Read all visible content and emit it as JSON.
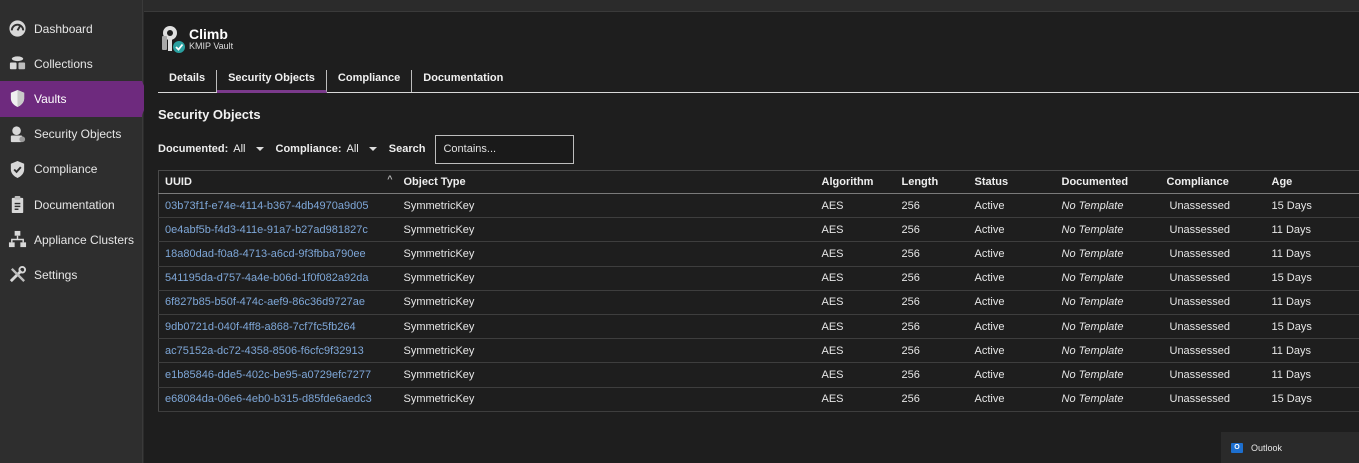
{
  "sidebar": {
    "items": [
      {
        "label": "Dashboard",
        "icon": "dashboard-icon"
      },
      {
        "label": "Collections",
        "icon": "collections-icon"
      },
      {
        "label": "Vaults",
        "icon": "vault-shield-icon",
        "active": true
      },
      {
        "label": "Security Objects",
        "icon": "security-objects-icon"
      },
      {
        "label": "Compliance",
        "icon": "compliance-shield-icon"
      },
      {
        "label": "Documentation",
        "icon": "documentation-icon"
      },
      {
        "label": "Appliance Clusters",
        "icon": "appliance-clusters-icon"
      },
      {
        "label": "Settings",
        "icon": "settings-icon"
      }
    ]
  },
  "header": {
    "title": "Climb",
    "subtitle": "KMIP Vault",
    "icon": "vault-keys-icon"
  },
  "tabs": [
    {
      "label": "Details"
    },
    {
      "label": "Security Objects",
      "active": true
    },
    {
      "label": "Compliance"
    },
    {
      "label": "Documentation"
    }
  ],
  "section": {
    "title": "Security Objects"
  },
  "filters": {
    "documented_label": "Documented:",
    "documented_value": "All",
    "compliance_label": "Compliance:",
    "compliance_value": "All",
    "search_label": "Search",
    "search_placeholder": "Contains..."
  },
  "table": {
    "columns": [
      "UUID",
      "Object Type",
      "Algorithm",
      "Length",
      "Status",
      "Documented",
      "Compliance",
      "Age"
    ],
    "sort_indicator": "^",
    "rows": [
      [
        "03b73f1f-e74e-4114-b367-4db4970a9d05",
        "SymmetricKey",
        "AES",
        "256",
        "Active",
        "No Template",
        "Unassessed",
        "15 Days"
      ],
      [
        "0e4abf5b-f4d3-411e-91a7-b27ad981827c",
        "SymmetricKey",
        "AES",
        "256",
        "Active",
        "No Template",
        "Unassessed",
        "11 Days"
      ],
      [
        "18a80dad-f0a8-4713-a6cd-9f3fbba790ee",
        "SymmetricKey",
        "AES",
        "256",
        "Active",
        "No Template",
        "Unassessed",
        "11 Days"
      ],
      [
        "541195da-d757-4a4e-b06d-1f0f082a92da",
        "SymmetricKey",
        "AES",
        "256",
        "Active",
        "No Template",
        "Unassessed",
        "15 Days"
      ],
      [
        "6f827b85-b50f-474c-aef9-86c36d9727ae",
        "SymmetricKey",
        "AES",
        "256",
        "Active",
        "No Template",
        "Unassessed",
        "11 Days"
      ],
      [
        "9db0721d-040f-4ff8-a868-7cf7fc5fb264",
        "SymmetricKey",
        "AES",
        "256",
        "Active",
        "No Template",
        "Unassessed",
        "15 Days"
      ],
      [
        "ac75152a-dc72-4358-8506-f6cfc9f32913",
        "SymmetricKey",
        "AES",
        "256",
        "Active",
        "No Template",
        "Unassessed",
        "11 Days"
      ],
      [
        "e1b85846-dde5-402c-be95-a0729efc7277",
        "SymmetricKey",
        "AES",
        "256",
        "Active",
        "No Template",
        "Unassessed",
        "11 Days"
      ],
      [
        "e68084da-06e6-4eb0-b315-d85fde6aedc3",
        "SymmetricKey",
        "AES",
        "256",
        "Active",
        "No Template",
        "Unassessed",
        "15 Days"
      ]
    ]
  },
  "taskbar": {
    "outlook_label": "Outlook",
    "icon": "outlook-icon"
  },
  "colors": {
    "accent": "#6e2a7e",
    "link": "#7ea7d8",
    "background": "#1e1e1e",
    "sidebar": "#2e2e2e"
  }
}
